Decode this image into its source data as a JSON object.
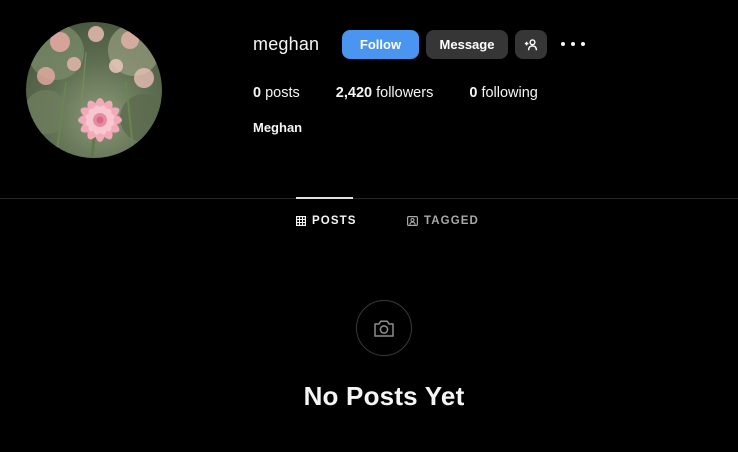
{
  "profile": {
    "username": "meghan",
    "full_name": "Meghan",
    "avatar_icon": "dahlia-flower-photo"
  },
  "actions": {
    "follow_label": "Follow",
    "message_label": "Message",
    "suggest_icon": "add-person-icon",
    "more_icon": "more-options-icon"
  },
  "stats": {
    "posts_count": "0",
    "posts_label": "posts",
    "followers_count": "2,420",
    "followers_label": "followers",
    "following_count": "0",
    "following_label": "following"
  },
  "tabs": [
    {
      "label": "POSTS",
      "icon": "grid-icon",
      "active": true
    },
    {
      "label": "TAGGED",
      "icon": "tagged-icon",
      "active": false
    }
  ],
  "empty_state": {
    "icon": "camera-icon",
    "title": "No Posts Yet"
  },
  "colors": {
    "background": "#000000",
    "follow_button": "#4a95f0",
    "secondary_button": "#363636",
    "text": "#f5f5f5",
    "muted_text": "#a8a8a8"
  }
}
